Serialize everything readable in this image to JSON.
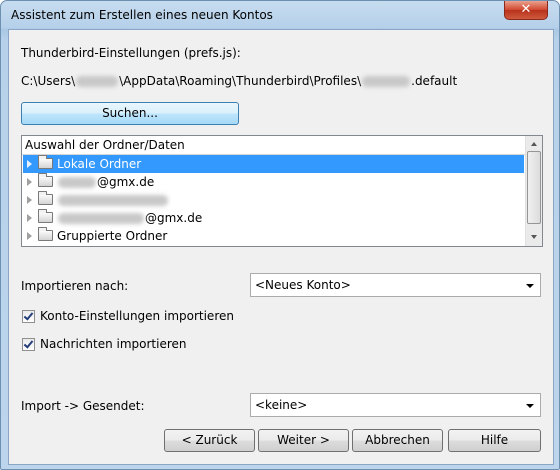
{
  "window": {
    "title": "Assistent zum Erstellen eines neuen Kontos",
    "close_label": "✕"
  },
  "prefs": {
    "label": "Thunderbird-Einstellungen (prefs.js):",
    "path_prefix": "C:\\Users\\",
    "path_middle": "\\AppData\\Roaming\\Thunderbird\\Profiles\\",
    "path_suffix": ".default",
    "search_button": "Suchen..."
  },
  "tree": {
    "header": "Auswahl der Ordner/Daten",
    "items": [
      {
        "label": "Lokale Ordner",
        "selected": true
      },
      {
        "label": "@gmx.de",
        "selected": false
      },
      {
        "label": "",
        "selected": false
      },
      {
        "label": "@gmx.de",
        "selected": false
      },
      {
        "label": "Gruppierte Ordner",
        "selected": false
      }
    ]
  },
  "import_to": {
    "label": "Importieren nach:",
    "value": "<Neues Konto>"
  },
  "checkboxes": {
    "account_settings": {
      "label": "Konto-Einstellungen importieren",
      "checked": true
    },
    "messages": {
      "label": "Nachrichten importieren",
      "checked": true
    }
  },
  "sent": {
    "label": "Import -> Gesendet:",
    "value": "<keine>"
  },
  "buttons": {
    "back": "< Zurück",
    "next": "Weiter >",
    "cancel": "Abbrechen",
    "help": "Hilfe"
  }
}
